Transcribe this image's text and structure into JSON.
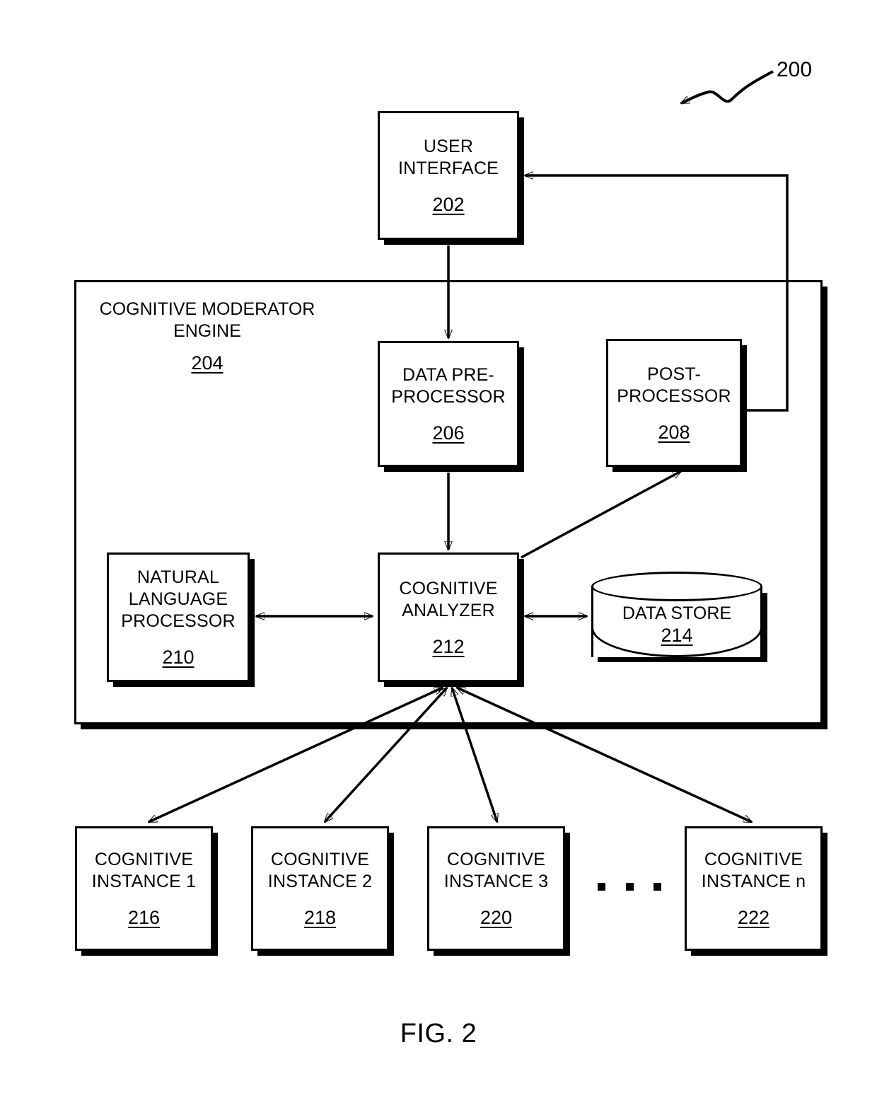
{
  "figure": {
    "caption_prefix": "FIG",
    "caption_suffix": ". 2",
    "reference_numeral": "200"
  },
  "engine": {
    "label": "COGNITIVE MODERATOR\nENGINE",
    "refnum": "204"
  },
  "nodes": {
    "user_interface": {
      "label": "USER\nINTERFACE",
      "refnum": "202"
    },
    "data_preprocessor": {
      "label": "DATA PRE-\nPROCESSOR",
      "refnum": "206"
    },
    "post_processor": {
      "label": "POST-\nPROCESSOR",
      "refnum": "208"
    },
    "natural_language_processor": {
      "label": "NATURAL\nLANGUAGE\nPROCESSOR",
      "refnum": "210"
    },
    "cognitive_analyzer": {
      "label": "COGNITIVE\nANALYZER",
      "refnum": "212"
    },
    "data_store": {
      "label": "DATA STORE",
      "refnum": "214"
    },
    "cognitive_instance_1": {
      "label": "COGNITIVE\nINSTANCE 1",
      "refnum": "216"
    },
    "cognitive_instance_2": {
      "label": "COGNITIVE\nINSTANCE 2",
      "refnum": "218"
    },
    "cognitive_instance_3": {
      "label": "COGNITIVE\nINSTANCE 3",
      "refnum": "220"
    },
    "cognitive_instance_n": {
      "label": "COGNITIVE\nINSTANCE n",
      "refnum": "222"
    }
  },
  "ellipsis": {
    "label": ". . ."
  }
}
